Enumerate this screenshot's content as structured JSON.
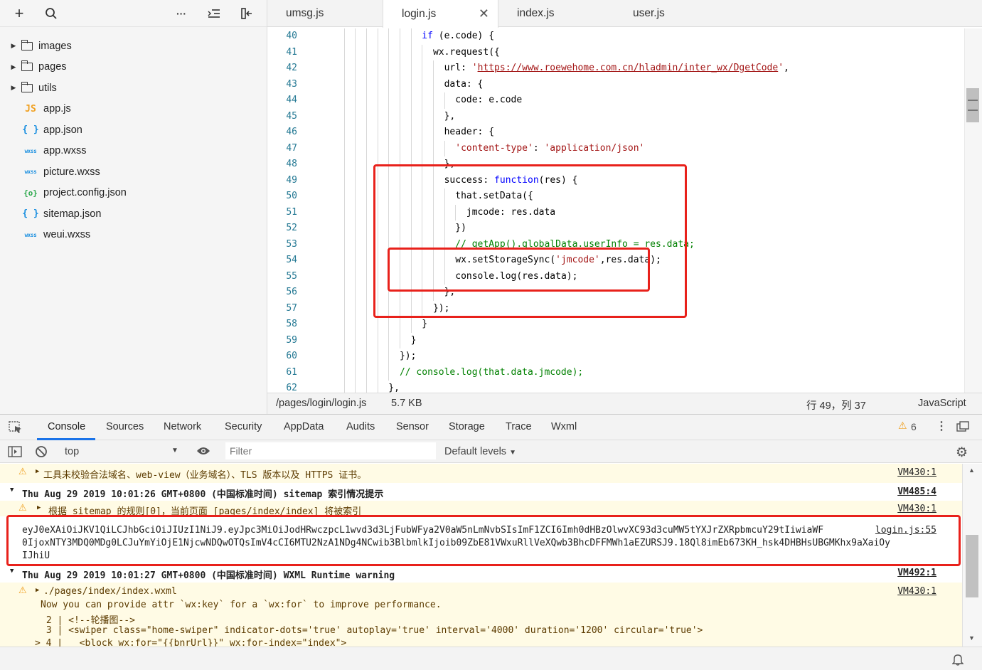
{
  "sidebar": {
    "toolbar": {
      "add": "+",
      "search": "⌕",
      "more": "···",
      "outline": "⇤",
      "collapse": "⊏"
    },
    "files": [
      {
        "name": "images",
        "type": "folder"
      },
      {
        "name": "pages",
        "type": "folder"
      },
      {
        "name": "utils",
        "type": "folder"
      },
      {
        "name": "app.js",
        "type": "js",
        "icon": "JS"
      },
      {
        "name": "app.json",
        "type": "json",
        "icon": "{ }"
      },
      {
        "name": "app.wxss",
        "type": "wxss",
        "icon": "wxss"
      },
      {
        "name": "picture.wxss",
        "type": "wxss",
        "icon": "wxss"
      },
      {
        "name": "project.config.json",
        "type": "cfg",
        "icon": "{o}"
      },
      {
        "name": "sitemap.json",
        "type": "json",
        "icon": "{ }"
      },
      {
        "name": "weui.wxss",
        "type": "wxss",
        "icon": "wxss"
      }
    ]
  },
  "editor": {
    "tabs": [
      "umsg.js",
      "login.js",
      "index.js",
      "user.js"
    ],
    "active_tab": "login.js",
    "lines": [
      {
        "n": "40",
        "indent": 8,
        "segs": [
          [
            "kw",
            "if"
          ],
          [
            "t",
            " (e.code) {"
          ]
        ]
      },
      {
        "n": "41",
        "indent": 9,
        "segs": [
          [
            "t",
            "wx.request({"
          ]
        ]
      },
      {
        "n": "42",
        "indent": 10,
        "segs": [
          [
            "t",
            "url: "
          ],
          [
            "str",
            "'"
          ],
          [
            "url",
            "https://www.roewehome.com.cn/hladmin/inter_wx/DgetCode"
          ],
          [
            "str",
            "'"
          ],
          [
            "t",
            ","
          ]
        ]
      },
      {
        "n": "43",
        "indent": 10,
        "segs": [
          [
            "t",
            "data: {"
          ]
        ]
      },
      {
        "n": "44",
        "indent": 11,
        "segs": [
          [
            "t",
            "code: e.code"
          ]
        ]
      },
      {
        "n": "45",
        "indent": 10,
        "segs": [
          [
            "t",
            "},"
          ]
        ]
      },
      {
        "n": "46",
        "indent": 10,
        "segs": [
          [
            "t",
            "header: {"
          ]
        ]
      },
      {
        "n": "47",
        "indent": 11,
        "segs": [
          [
            "str",
            "'content-type'"
          ],
          [
            "t",
            ": "
          ],
          [
            "str",
            "'application/json'"
          ]
        ]
      },
      {
        "n": "48",
        "indent": 10,
        "segs": [
          [
            "t",
            "},"
          ]
        ]
      },
      {
        "n": "49",
        "indent": 10,
        "segs": [
          [
            "t",
            "success: "
          ],
          [
            "kw",
            "function"
          ],
          [
            "t",
            "(res) {"
          ]
        ]
      },
      {
        "n": "50",
        "indent": 11,
        "segs": [
          [
            "t",
            "that.setData({"
          ]
        ]
      },
      {
        "n": "51",
        "indent": 12,
        "segs": [
          [
            "t",
            "jmcode: res.data"
          ]
        ]
      },
      {
        "n": "52",
        "indent": 11,
        "segs": [
          [
            "t",
            "})"
          ]
        ]
      },
      {
        "n": "53",
        "indent": 11,
        "segs": [
          [
            "cm",
            "// getApp().globalData.userInfo = res.data;"
          ]
        ]
      },
      {
        "n": "54",
        "indent": 11,
        "segs": [
          [
            "t",
            "wx.setStorageSync("
          ],
          [
            "str",
            "'jmcode'"
          ],
          [
            "t",
            ",res.data);"
          ]
        ]
      },
      {
        "n": "55",
        "indent": 11,
        "segs": [
          [
            "t",
            "console.log(res.data);"
          ]
        ]
      },
      {
        "n": "56",
        "indent": 10,
        "segs": [
          [
            "t",
            "},"
          ]
        ]
      },
      {
        "n": "57",
        "indent": 9,
        "segs": [
          [
            "t",
            "});"
          ]
        ]
      },
      {
        "n": "58",
        "indent": 8,
        "segs": [
          [
            "t",
            "}"
          ]
        ]
      },
      {
        "n": "59",
        "indent": 7,
        "segs": [
          [
            "t",
            "}"
          ]
        ]
      },
      {
        "n": "60",
        "indent": 6,
        "segs": [
          [
            "t",
            "});"
          ]
        ]
      },
      {
        "n": "61",
        "indent": 6,
        "segs": [
          [
            "cm",
            "// console.log(that.data.jmcode);"
          ]
        ]
      },
      {
        "n": "62",
        "indent": 5,
        "segs": [
          [
            "t",
            "},"
          ]
        ]
      }
    ],
    "status": {
      "path": "/pages/login/login.js",
      "size": "5.7 KB",
      "position": "行 49，列 37",
      "language": "JavaScript"
    }
  },
  "devtools": {
    "tabs": [
      "Console",
      "Sources",
      "Network",
      "Security",
      "AppData",
      "Audits",
      "Sensor",
      "Storage",
      "Trace",
      "Wxml"
    ],
    "active_tab": "Console",
    "warning_count": "6",
    "toolbar": {
      "context": "top",
      "filter_placeholder": "Filter",
      "levels": "Default levels"
    },
    "console": {
      "r1_text": "工具未校验合法域名、web-view（业务域名）、TLS 版本以及 HTTPS 证书。",
      "r1_src": "VM430:1",
      "r2_text": "Thu Aug 29 2019 10:01:26 GMT+0800 (中国标准时间) sitemap 索引情况提示",
      "r2_src": "VM485:4",
      "r3_text": "根据 sitemap 的规则[0]，当前页面 [pages/index/index] 将被索引",
      "r3_src": "VM430:1",
      "r4_line1": "eyJ0eXAiOiJKV1QiLCJhbGciOiJIUzI1NiJ9.eyJpc3MiOiJodHRwczpcL1wvd3d3LjFubWFya2V0aW5nLmNvbSIsImF1ZCI6Imh0dHBzOlwvXC93d3cuMW5tYXJrZXRpbmcuY29tIiwiaWF",
      "r4_line2": "0IjoxNTY3MDQ0MDg0LCJuYmYiOjE1NjcwNDQwOTQsImV4cCI6MTU2NzA1NDg4NCwib3BlbmlkIjoib09ZbE81VWxuRllVeXQwb3BhcDFFMWh1aEZURSJ9.18Ql8imEb673KH_hsk4DHBHsUBGMKhx9aXaiOy",
      "r4_line3": "IJhiU",
      "r4_src": "login.js:55",
      "r5_text": "Thu Aug 29 2019 10:01:27 GMT+0800 (中国标准时间) WXML Runtime warning",
      "r5_src": "VM492:1",
      "r6_text": "./pages/index/index.wxml",
      "r6_src": "VM430:1",
      "r7_text": "Now you can provide attr `wx:key` for a `wx:for` to improve performance.",
      "r8_text": " 2 | <!--轮播图-->",
      "r9_text": " 3 | <swiper class=\"home-swiper\" indicator-dots='true' autoplay='true' interval='4000' duration='1200' circular='true'>",
      "r10_text": "> 4 |   <block wx:for=\"{{bnrUrl}}\" wx:for-index=\"index\">"
    }
  }
}
